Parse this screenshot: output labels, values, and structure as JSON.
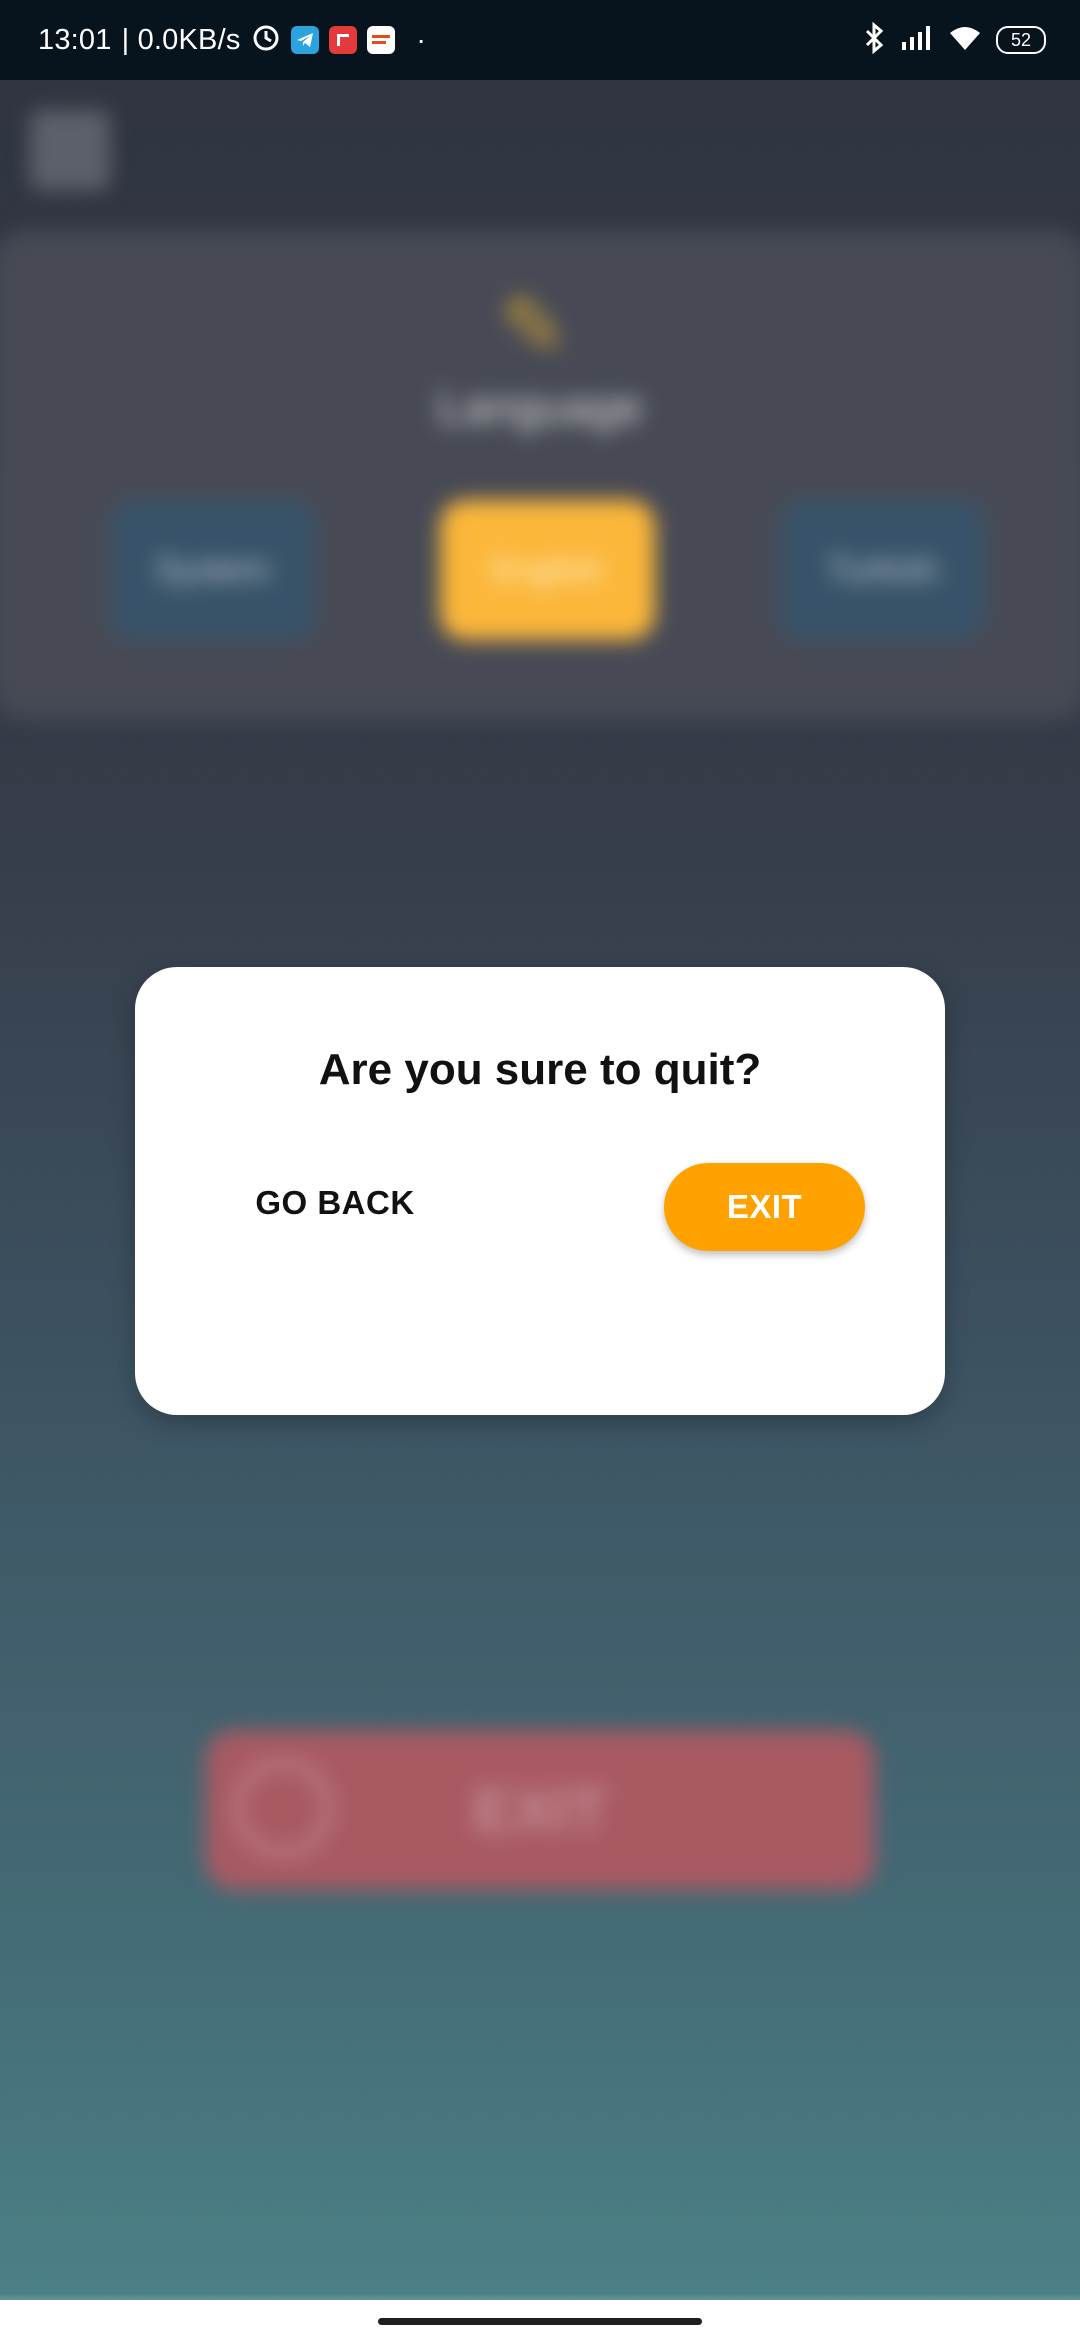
{
  "status_bar": {
    "time": "13:01",
    "network_speed": "| 0.0KB/s",
    "battery": "52",
    "icons": [
      "alarm-icon",
      "telegram-icon",
      "app-icon",
      "brand-icon",
      "bluetooth-icon",
      "signal-icon",
      "wifi-icon",
      "battery-icon"
    ]
  },
  "background_app": {
    "language_title": "Language",
    "language_options": [
      "System",
      "English",
      "Turkish"
    ],
    "selected_language": "English",
    "exit_label": "EXIT"
  },
  "dialog": {
    "title": "Are you sure to quit?",
    "go_back_label": "GO BACK",
    "exit_label": "EXIT"
  },
  "colors": {
    "accent": "#ffa200",
    "dialog_background": "#ffffff",
    "status_bar": "#07141d"
  }
}
